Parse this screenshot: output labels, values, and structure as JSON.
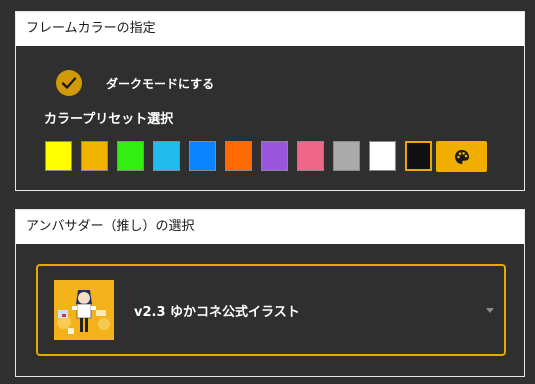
{
  "color_section": {
    "title": "フレームカラーの指定",
    "dark_mode": {
      "label": "ダークモードにする",
      "checked": true
    },
    "preset_title": "カラープリセット選択",
    "presets": [
      {
        "name": "yellow",
        "color": "#ffff00"
      },
      {
        "name": "amber",
        "color": "#f0b400"
      },
      {
        "name": "green",
        "color": "#33ee11"
      },
      {
        "name": "sky-blue",
        "color": "#22bbee"
      },
      {
        "name": "blue",
        "color": "#0a84ff"
      },
      {
        "name": "orange",
        "color": "#ff6a00"
      },
      {
        "name": "purple",
        "color": "#9955dd"
      },
      {
        "name": "pink",
        "color": "#ee6688"
      },
      {
        "name": "gray",
        "color": "#aaaaaa"
      },
      {
        "name": "white",
        "color": "#ffffff"
      },
      {
        "name": "black",
        "color": "#111111"
      }
    ],
    "selected_preset": "black",
    "custom_color_icon": "palette-icon",
    "accent_color": "#f0ae00"
  },
  "ambassador_section": {
    "title": "アンバサダー（推し）の選択",
    "selected_label": "v2.3 ゆかコネ公式イラスト",
    "dropdown_icon": "chevron-down-icon",
    "border_color": "#e5a900"
  }
}
